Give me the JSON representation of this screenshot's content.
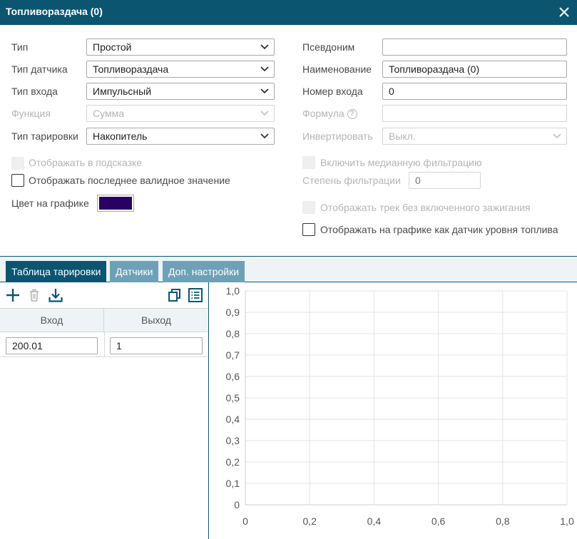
{
  "dialog": {
    "title": "Топливораздача (0)"
  },
  "form": {
    "type_label": "Тип",
    "type_value": "Простой",
    "sensor_type_label": "Тип датчика",
    "sensor_type_value": "Топливораздача",
    "input_type_label": "Тип входа",
    "input_type_value": "Импульсный",
    "function_label": "Функция",
    "function_value": "Сумма",
    "calibration_type_label": "Тип тарировки",
    "calibration_type_value": "Накопитель",
    "alias_label": "Псевдоним",
    "alias_value": "",
    "name_label": "Наименование",
    "name_value": "Топливораздача (0)",
    "input_number_label": "Номер входа",
    "input_number_value": "0",
    "formula_label": "Формула",
    "formula_value": "",
    "invert_label": "Инвертировать",
    "invert_value": "Выкл.",
    "show_in_tooltip_label": "Отображать в подсказке",
    "show_last_valid_label": "Отображать последнее валидное значение",
    "chart_color_label": "Цвет на графике",
    "chart_color": "#2a0062",
    "median_filter_label": "Включить медианную фильтрацию",
    "filter_degree_label": "Степень фильтрации",
    "filter_degree_placeholder": "0",
    "show_track_no_ignition_label": "Отображать трек без включенного зажигания",
    "show_as_fuel_level_label": "Отображать на графике как датчик уровня топлива"
  },
  "tabs": [
    {
      "label": "Таблица тарировки",
      "active": true
    },
    {
      "label": "Датчики",
      "active": false
    },
    {
      "label": "Доп. настройки",
      "active": false
    }
  ],
  "table": {
    "headers": [
      "Вход",
      "Выход"
    ],
    "rows": [
      {
        "input": "200.01",
        "output": "1"
      }
    ]
  },
  "chart_data": {
    "type": "line",
    "series": [],
    "xlim": [
      0,
      1
    ],
    "ylim": [
      0,
      1
    ],
    "x_ticks": [
      "0",
      "0,2",
      "0,4",
      "0,6",
      "0,8",
      "1,0"
    ],
    "y_ticks": [
      "0",
      "0,1",
      "0,2",
      "0,3",
      "0,4",
      "0,5",
      "0,6",
      "0,7",
      "0,8",
      "0,9",
      "1,0"
    ],
    "grid": true
  },
  "colors": {
    "header_bg": "#0b5570",
    "tab_inactive": "#6ea1b6",
    "icon": "#0b5570"
  }
}
